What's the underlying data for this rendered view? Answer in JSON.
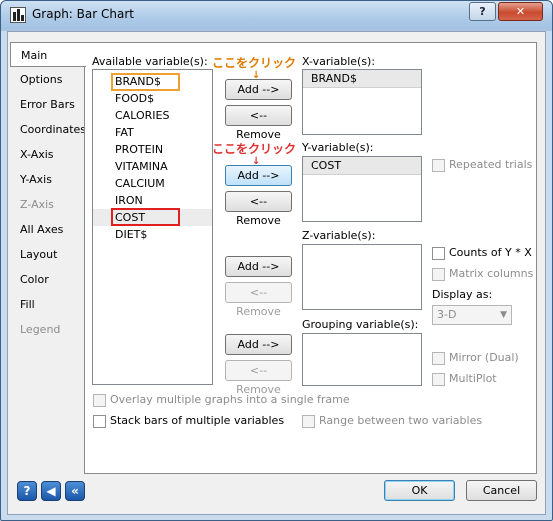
{
  "window": {
    "title": "Graph: Bar Chart"
  },
  "titlebar": {
    "help_label": "?",
    "close_label": "✕"
  },
  "tabs": [
    {
      "label": "Main",
      "state": "active"
    },
    {
      "label": "Options",
      "state": "normal"
    },
    {
      "label": "Error Bars",
      "state": "normal"
    },
    {
      "label": "Coordinates",
      "state": "normal"
    },
    {
      "label": "X-Axis",
      "state": "normal"
    },
    {
      "label": "Y-Axis",
      "state": "normal"
    },
    {
      "label": "Z-Axis",
      "state": "disabled"
    },
    {
      "label": "All Axes",
      "state": "normal"
    },
    {
      "label": "Layout",
      "state": "normal"
    },
    {
      "label": "Color",
      "state": "normal"
    },
    {
      "label": "Fill",
      "state": "normal"
    },
    {
      "label": "Legend",
      "state": "disabled"
    }
  ],
  "available": {
    "label": "Available variable(s):",
    "items": [
      "BRAND$",
      "FOOD$",
      "CALORIES",
      "FAT",
      "PROTEIN",
      "VITAMINA",
      "CALCIUM",
      "IRON",
      "COST",
      "DIET$"
    ]
  },
  "x_var": {
    "label": "X-variable(s):",
    "value": "BRAND$",
    "add": "Add -->",
    "remove": "<-- Remove",
    "callout": "ここをクリック"
  },
  "y_var": {
    "label": "Y-variable(s):",
    "value": "COST",
    "add": "Add -->",
    "remove": "<-- Remove",
    "callout": "ここをクリック"
  },
  "z_var": {
    "label": "Z-variable(s):",
    "add": "Add -->",
    "remove": "<-- Remove"
  },
  "grouping": {
    "label": "Grouping variable(s):",
    "add": "Add -->",
    "remove": "<-- Remove"
  },
  "options": {
    "repeated_trials": "Repeated trials",
    "counts": "Counts of Y * X",
    "matrix_columns": "Matrix columns",
    "display_as": "Display as:",
    "display_value": "3-D",
    "mirror": "Mirror (Dual)",
    "multiplot": "MultiPlot",
    "overlay": "Overlay multiple graphs into a single frame",
    "stack": "Stack bars of multiple variables",
    "range": "Range between two variables"
  },
  "footer": {
    "ok": "OK",
    "cancel": "Cancel",
    "help_icon": "?",
    "back_icon": "◀",
    "first_icon": "«"
  },
  "colors": {
    "callout_orange": "#e07b00",
    "callout_red": "#e03030",
    "highlight_orange": "#f0a030",
    "highlight_red": "#e02020"
  }
}
